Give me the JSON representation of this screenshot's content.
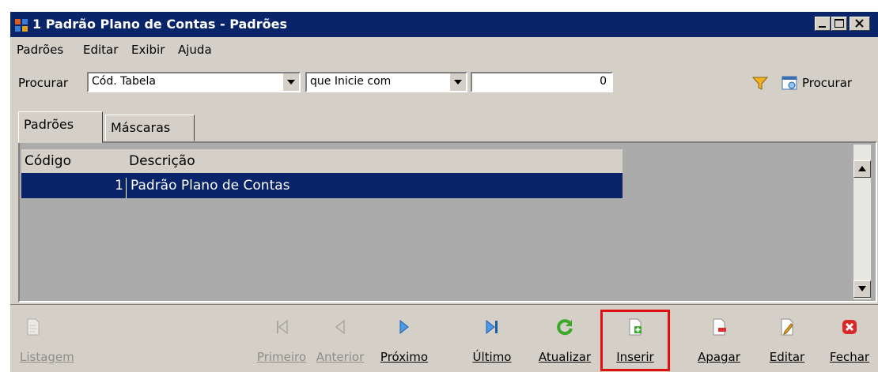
{
  "window": {
    "title": "1 Padrão Plano de Contas - Padrões"
  },
  "menu": [
    "Padrões",
    "Editar",
    "Exibir",
    "Ajuda"
  ],
  "search": {
    "label": "Procurar",
    "field": "Cód. Tabela",
    "condition": "que Inicie com",
    "value": "0",
    "search_button": "Procurar"
  },
  "tabs": [
    {
      "label": "Padrões",
      "active": true
    },
    {
      "label": "Máscaras",
      "active": false
    }
  ],
  "grid": {
    "columns": [
      "Código",
      "Descrição"
    ],
    "rows": [
      {
        "codigo": "1",
        "descricao": "Padrão Plano de Contas",
        "selected": true
      }
    ]
  },
  "toolbar": {
    "listagem": "Listagem",
    "primeiro": "Primeiro",
    "anterior": "Anterior",
    "proximo": "Próximo",
    "ultimo": "Último",
    "atualizar": "Atualizar",
    "inserir": "Inserir",
    "apagar": "Apagar",
    "editar": "Editar",
    "fechar": "Fechar"
  },
  "colors": {
    "title_bar": "#0a246a",
    "selection": "#0a246a",
    "highlight_box": "#e01010",
    "window_bg": "#d4d0c8"
  }
}
